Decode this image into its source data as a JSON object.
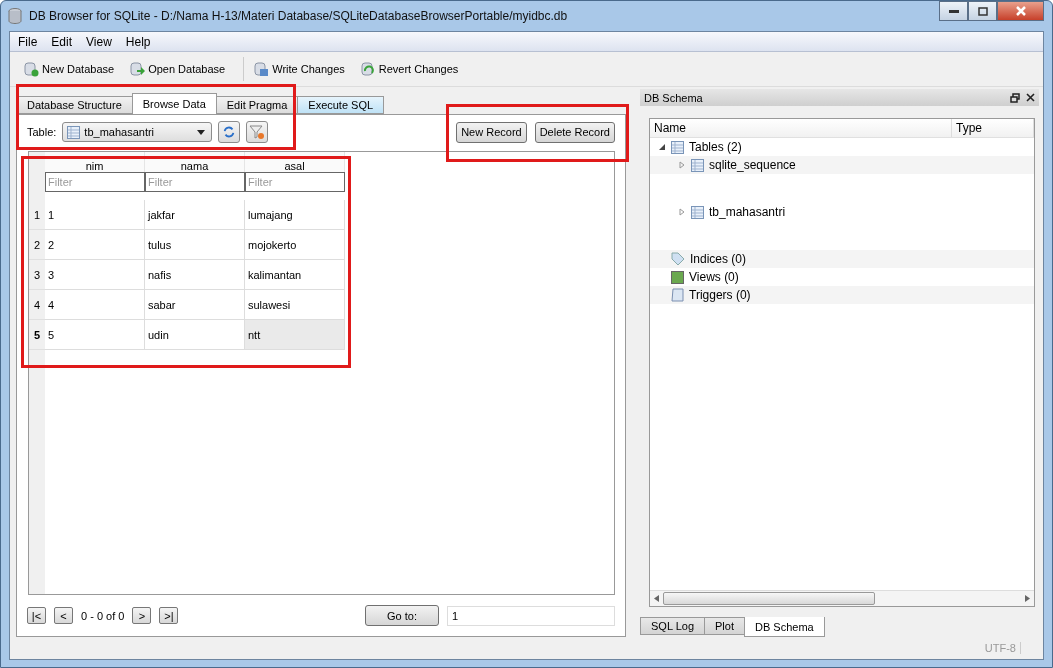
{
  "window": {
    "title": "DB Browser for SQLite - D:/Nama H-13/Materi Database/SQLiteDatabaseBrowserPortable/myidbc.db"
  },
  "menu": [
    "File",
    "Edit",
    "View",
    "Help"
  ],
  "toolbar": [
    "New Database",
    "Open Database",
    "Write Changes",
    "Revert Changes"
  ],
  "tabs": [
    {
      "label": "Database Structure",
      "selected": false
    },
    {
      "label": "Browse Data",
      "selected": true
    },
    {
      "label": "Edit Pragma",
      "selected": false
    },
    {
      "label": "Execute SQL",
      "selected": false
    }
  ],
  "browse": {
    "table_label": "Table:",
    "table_value": "tb_mahasantri",
    "buttons": [
      "New Record",
      "Delete Record"
    ],
    "columns": [
      "nim",
      "nama",
      "asal"
    ],
    "filters": [
      {
        "placeholder": "Filter"
      },
      {
        "placeholder": "Filter"
      },
      {
        "placeholder": "Filter"
      }
    ],
    "rows": [
      {
        "header": "1",
        "selected": false,
        "cells": [
          {
            "text": "1",
            "selected": false
          },
          {
            "text": "jakfar",
            "selected": false
          },
          {
            "text": "lumajang",
            "selected": false
          }
        ]
      },
      {
        "header": "2",
        "selected": false,
        "cells": [
          {
            "text": "2",
            "selected": false
          },
          {
            "text": "tulus",
            "selected": false
          },
          {
            "text": "mojokerto",
            "selected": false
          }
        ]
      },
      {
        "header": "3",
        "selected": false,
        "cells": [
          {
            "text": "3",
            "selected": false
          },
          {
            "text": "nafis",
            "selected": false
          },
          {
            "text": "kalimantan",
            "selected": false
          }
        ]
      },
      {
        "header": "4",
        "selected": false,
        "cells": [
          {
            "text": "4",
            "selected": false
          },
          {
            "text": "sabar",
            "selected": false
          },
          {
            "text": "sulawesi",
            "selected": false
          }
        ]
      },
      {
        "header": "5",
        "selected": true,
        "cells": [
          {
            "text": "5",
            "selected": false
          },
          {
            "text": "udin",
            "selected": false
          },
          {
            "text": "ntt",
            "selected": true
          }
        ]
      }
    ],
    "nav": [
      "|<",
      "<",
      "0 - 0 of 0",
      ">",
      ">|"
    ],
    "goto_button": "Go to:",
    "goto_value": "1"
  },
  "schema": {
    "title": "DB Schema",
    "columns": [
      "Name",
      "Type"
    ],
    "tree": [
      {
        "label": "Tables (2)",
        "kind": "tables",
        "expanded": true,
        "children": [
          {
            "label": "sqlite_sequence",
            "kind": "table",
            "expanded": false
          },
          {
            "label": "tb_mahasantri",
            "kind": "table",
            "expanded": false
          }
        ]
      },
      {
        "label": "Indices (0)",
        "kind": "indices"
      },
      {
        "label": "Views (0)",
        "kind": "views"
      },
      {
        "label": "Triggers (0)",
        "kind": "triggers"
      }
    ],
    "bottom_tabs": [
      {
        "label": "SQL Log",
        "selected": false
      },
      {
        "label": "Plot",
        "selected": false
      },
      {
        "label": "DB Schema",
        "selected": true
      }
    ]
  },
  "status_bar": {
    "encoding": "UTF-8"
  }
}
